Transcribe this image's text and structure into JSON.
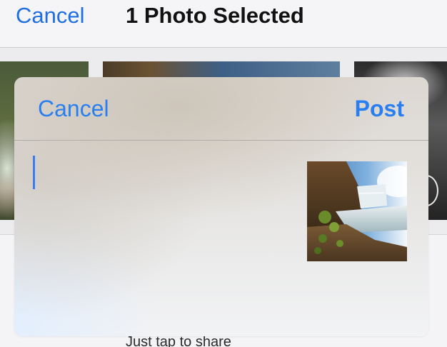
{
  "background": {
    "header": {
      "cancel_label": "Cancel",
      "title": "1 Photo Selected"
    },
    "hint_text": "Just tap to share"
  },
  "compose": {
    "cancel_label": "Cancel",
    "post_label": "Post",
    "text_value": ""
  },
  "colors": {
    "accent": "#2a7ff0",
    "caret": "#3a7cf5"
  },
  "icons": {
    "selection_indicator": "selection-circle-icon"
  }
}
